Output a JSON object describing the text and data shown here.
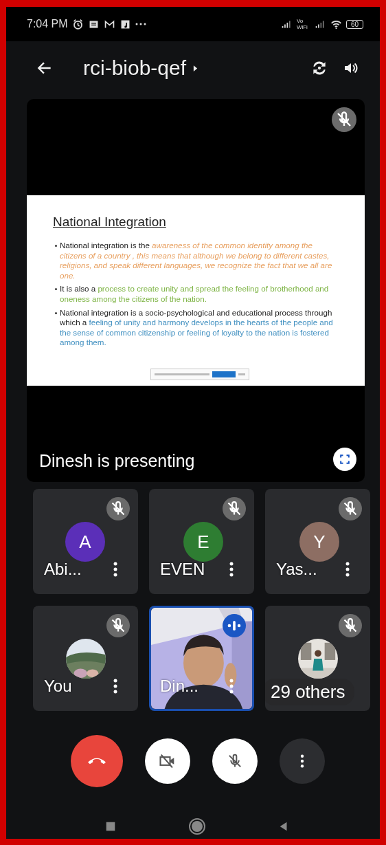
{
  "status_bar": {
    "time": "7:04 PM",
    "vowifi": "Vo WiFi",
    "battery": "60"
  },
  "top_bar": {
    "title": "rci-biob-qef"
  },
  "presentation": {
    "caption": "Dinesh is presenting",
    "muted": true,
    "slide": {
      "title": "National Integration",
      "bullets": [
        [
          {
            "text": "National integration is the ",
            "color": "#222222",
            "italic": false
          },
          {
            "text": "awareness of the common identity among the citizens of a country , this means that although we belong to different castes, religions, and speak different languages, we recognize the fact that we all are one.",
            "color": "#e8a060",
            "italic": true
          }
        ],
        [
          {
            "text": "It is also a ",
            "color": "#222222",
            "italic": false
          },
          {
            "text": "process to create unity and spread the feeling of brotherhood and oneness among the citizens of the nation.",
            "color": "#7cb342",
            "italic": false
          }
        ],
        [
          {
            "text": "National integration is a socio-psychological and educational process through which a ",
            "color": "#222222",
            "italic": false
          },
          {
            "text": "feeling of unity and harmony develops in the hearts of the people and the sense of common citizenship or feeling of loyalty to the nation is fostered among them.",
            "color": "#3f8fc0",
            "italic": false
          }
        ]
      ]
    }
  },
  "participants": [
    {
      "name": "Abi...",
      "kind": "letter",
      "initial": "A",
      "color": "#5b2fb8",
      "muted": true,
      "speaking": false
    },
    {
      "name": "EVEN",
      "kind": "letter",
      "initial": "E",
      "color": "#2e7d32",
      "muted": true,
      "speaking": false
    },
    {
      "name": "Yas...",
      "kind": "letter",
      "initial": "Y",
      "color": "#8d6e63",
      "muted": true,
      "speaking": false
    },
    {
      "name": "You",
      "muted": true,
      "speaking": false
    },
    {
      "name": "Din...",
      "kind": "video",
      "muted": false,
      "speaking": true
    },
    {
      "name": "29 others",
      "kind": "others",
      "muted": true,
      "speaking": false
    }
  ],
  "controls": [
    {
      "kind": "end"
    },
    {
      "kind": "camera",
      "on": false
    },
    {
      "kind": "mic",
      "on": false
    },
    {
      "kind": "more"
    }
  ]
}
